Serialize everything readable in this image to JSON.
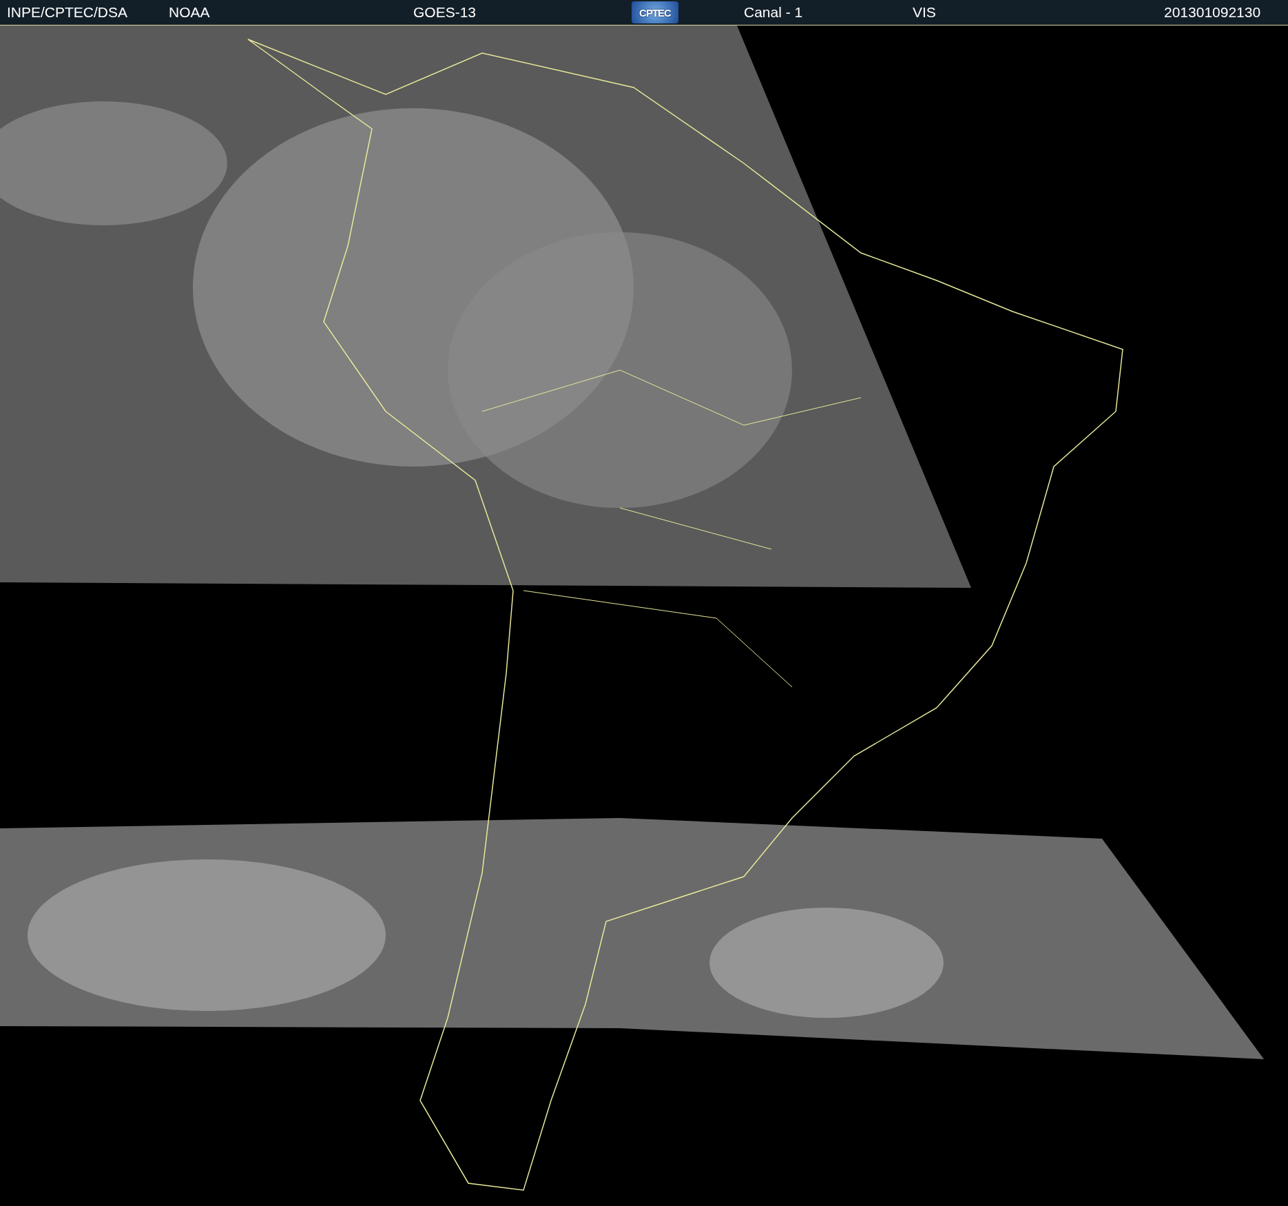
{
  "header": {
    "items": [
      {
        "kind": "text",
        "text": "INPE/CPTEC/DSA"
      },
      {
        "kind": "text",
        "text": "NOAA"
      },
      {
        "kind": "text",
        "text": "GOES-13"
      },
      {
        "kind": "logo",
        "text": "CPTEC"
      },
      {
        "kind": "text",
        "text": "Canal - 1"
      },
      {
        "kind": "text",
        "text": "VIS"
      },
      {
        "kind": "text",
        "text": "201301092130"
      }
    ]
  }
}
